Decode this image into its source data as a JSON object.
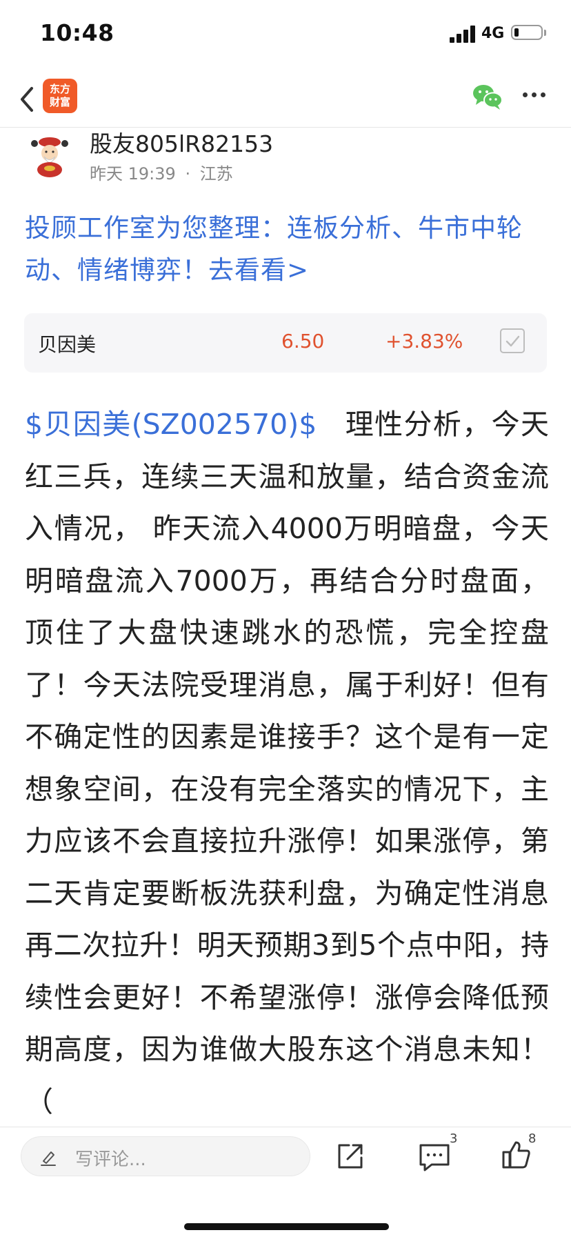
{
  "status_bar": {
    "time": "10:48",
    "network": "4G"
  },
  "nav": {
    "app_logo_text": "东方\n财富",
    "icons": [
      "back-icon",
      "wechat-share-icon",
      "more-icon"
    ]
  },
  "author": {
    "name": "股友805lR82153",
    "time": "昨天 19:39",
    "separator": "·",
    "location": "江苏"
  },
  "promo": {
    "text": "投顾工作室为您整理：连板分析、牛市中轮动、情绪博弈！去看看>"
  },
  "stock_card": {
    "name": "贝因美",
    "price": "6.50",
    "change": "+3.83%"
  },
  "post": {
    "stock_tag": "$贝因美(SZ002570)$",
    "body": "理性分析，今天红三兵，连续三天温和放量，结合资金流入情况， 昨天流入4000万明暗盘，今天明暗盘流入7000万，再结合分时盘面，顶住了大盘快速跳水的恐慌，完全控盘了！今天法院受理消息，属于利好！但有不确定性的因素是谁接手？这个是有一定想象空间，在没有完全落实的情况下，主力应该不会直接拉升涨停！如果涨停，第二天肯定要断板洗获利盘，为确定性消息再二次拉升！明天预期3到5个点中阳，持续性会更好！不希望涨停！涨停会降低预期高度，因为谁做大股东这个消息未知！（"
  },
  "bottom_bar": {
    "comment_placeholder": "写评论...",
    "comment_count": "3",
    "like_count": "8"
  },
  "colors": {
    "link_blue": "#3a6fd8",
    "stock_red": "#e0522f",
    "brand_orange": "#f05a28",
    "wechat_green": "#5bc45c"
  }
}
